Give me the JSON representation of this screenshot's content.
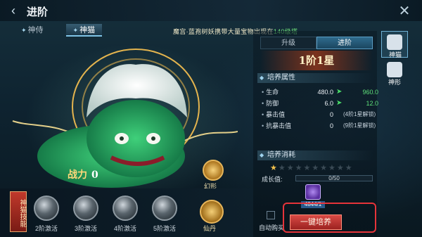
{
  "header": {
    "title": "进阶",
    "back_icon": "back-arrow-icon",
    "close_icon": "close-icon"
  },
  "tabs": [
    {
      "label": "神侍",
      "active": false
    },
    {
      "label": "神猫",
      "active": true
    }
  ],
  "notice": {
    "prefix": "魔宫·蓝孢树妖",
    "middle": "携带大量宝物出现在",
    "highlight": "140级塔"
  },
  "creature": {
    "power_label": "战力",
    "power_value": "0"
  },
  "morph": {
    "label": "幻形",
    "icon": "morph-icon"
  },
  "skills_tag": "神猫技能",
  "skills": [
    {
      "label": "2阶激活",
      "icon": "skill-locked-icon"
    },
    {
      "label": "3阶激活",
      "icon": "skill-locked-icon"
    },
    {
      "label": "4阶激活",
      "icon": "skill-locked-icon"
    },
    {
      "label": "5阶激活",
      "icon": "skill-locked-icon"
    }
  ],
  "elixir": {
    "label": "仙丹",
    "icon": "elixir-icon"
  },
  "panel": {
    "subtabs": [
      {
        "label": "升级",
        "active": false
      },
      {
        "label": "进阶",
        "active": true
      }
    ],
    "rank": "1阶1星",
    "attributes_title": "培养属性",
    "attributes": [
      {
        "name": "生命",
        "current": "480.0",
        "next": "960.0",
        "note": ""
      },
      {
        "name": "防御",
        "current": "6.0",
        "next": "12.0",
        "note": ""
      },
      {
        "name": "暴击值",
        "current": "0",
        "next": "",
        "note": "(4阶1星解锁)"
      },
      {
        "name": "抗暴击值",
        "current": "0",
        "next": "",
        "note": "(9阶1星解锁)"
      }
    ],
    "cost_title": "培养消耗",
    "stars": {
      "filled": 1,
      "total": 10
    },
    "growth": {
      "label": "成长值:",
      "value": "0/50",
      "fraction": 0.0
    },
    "item": {
      "count": "4844/1",
      "icon": "material-icon"
    },
    "auto_buy_label": "自动购买",
    "train_button": "一键培养"
  },
  "side_tabs": [
    {
      "label": "神猫",
      "icon": "cat-icon",
      "active": true
    },
    {
      "label": "神形",
      "icon": "form-icon",
      "active": false
    }
  ],
  "colors": {
    "accent": "#7fc3e6",
    "positive": "#5fe07a",
    "button": "#c9342f",
    "gold": "#f1c04d"
  }
}
